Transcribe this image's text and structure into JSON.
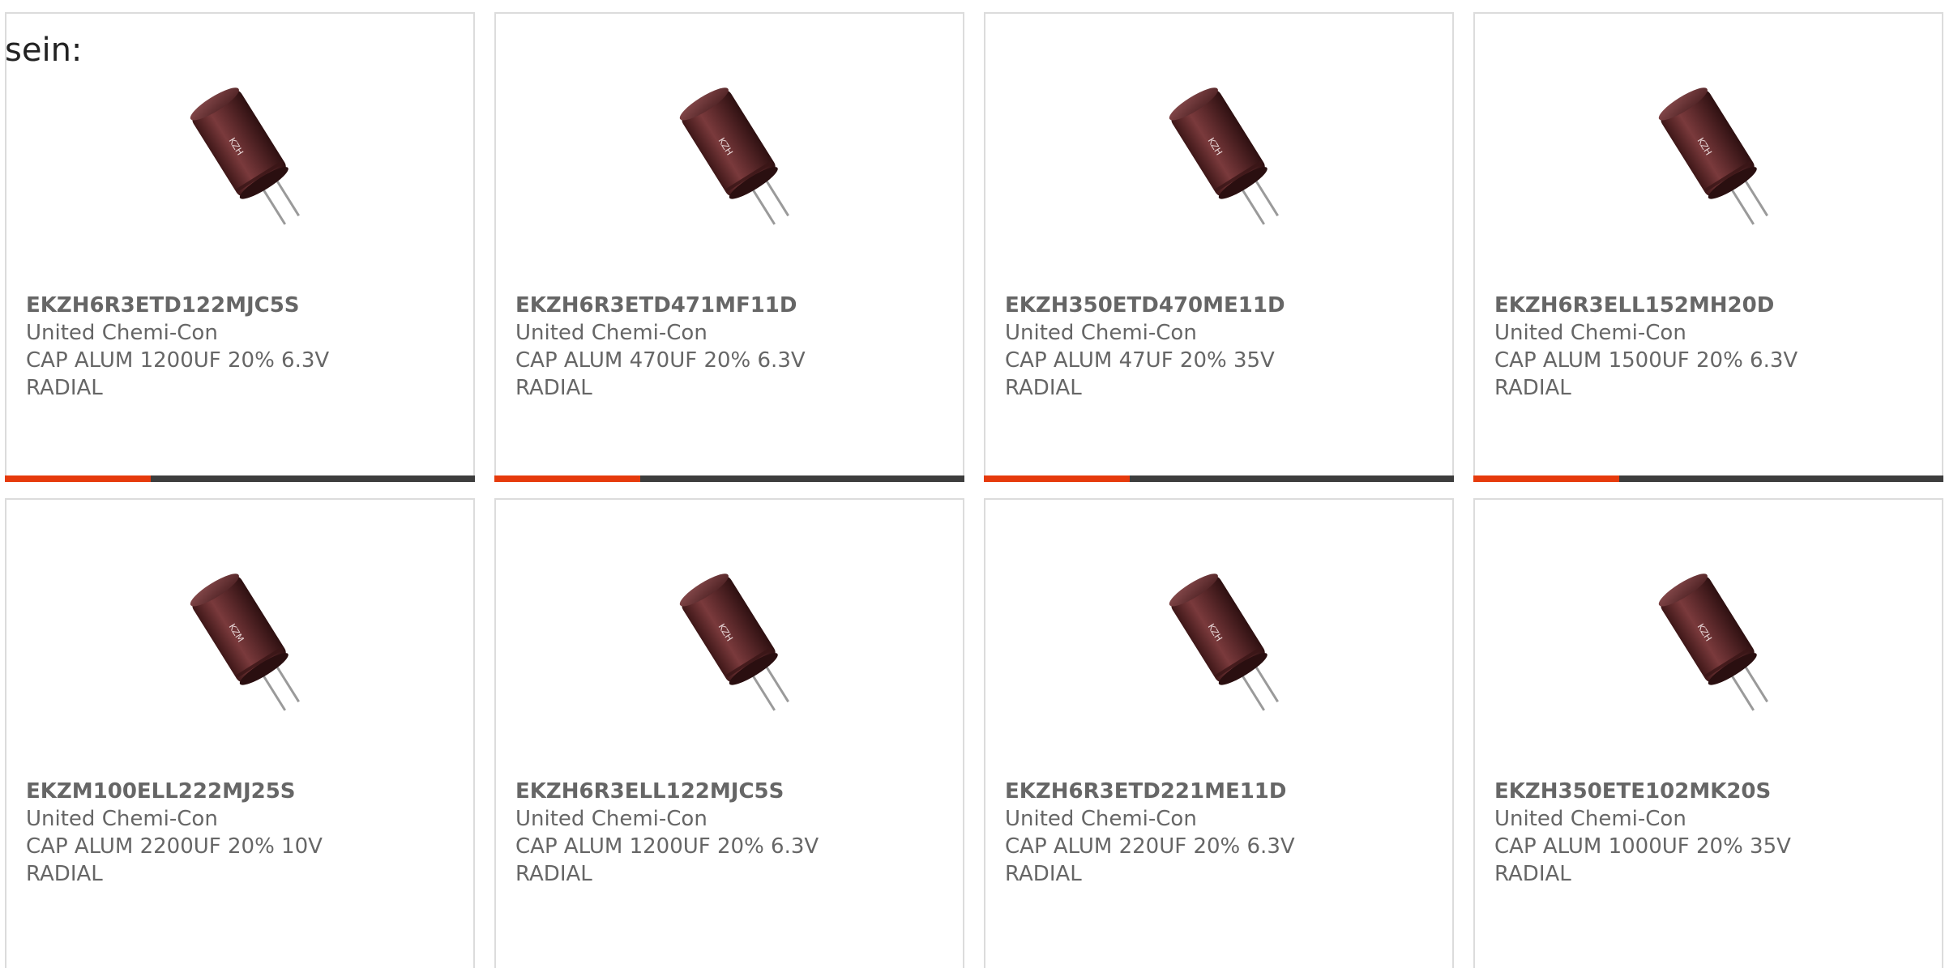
{
  "lead_text": "sein:",
  "colors": {
    "accent": "#e63a0c",
    "track": "#3d3d3d",
    "text": "#666666",
    "capacitor_body": "#5e2a2c"
  },
  "products": [
    {
      "part": "EKZH6R3ETD122MJC5S",
      "manufacturer": "United Chemi-Con",
      "description": "CAP ALUM 1200UF 20% 6.3V RADIAL",
      "sleeve_text": "KZH",
      "image_icon": "capacitor-icon",
      "progress": 0.31
    },
    {
      "part": "EKZH6R3ETD471MF11D",
      "manufacturer": "United Chemi-Con",
      "description": "CAP ALUM 470UF 20% 6.3V RADIAL",
      "sleeve_text": "KZH",
      "image_icon": "capacitor-icon",
      "progress": 0.31
    },
    {
      "part": "EKZH350ETD470ME11D",
      "manufacturer": "United Chemi-Con",
      "description": "CAP ALUM 47UF 20% 35V RADIAL",
      "sleeve_text": "KZH",
      "image_icon": "capacitor-icon",
      "progress": 0.31
    },
    {
      "part": "EKZH6R3ELL152MH20D",
      "manufacturer": "United Chemi-Con",
      "description": "CAP ALUM 1500UF 20% 6.3V RADIAL",
      "sleeve_text": "KZH",
      "image_icon": "capacitor-icon",
      "progress": 0.31
    },
    {
      "part": "EKZM100ELL222MJ25S",
      "manufacturer": "United Chemi-Con",
      "description": "CAP ALUM 2200UF 20% 10V RADIAL",
      "sleeve_text": "KZM",
      "image_icon": "capacitor-icon",
      "progress": 0
    },
    {
      "part": "EKZH6R3ELL122MJC5S",
      "manufacturer": "United Chemi-Con",
      "description": "CAP ALUM 1200UF 20% 6.3V RADIAL",
      "sleeve_text": "KZH",
      "image_icon": "capacitor-icon",
      "progress": 0
    },
    {
      "part": "EKZH6R3ETD221ME11D",
      "manufacturer": "United Chemi-Con",
      "description": "CAP ALUM 220UF 20% 6.3V RADIAL",
      "sleeve_text": "KZH",
      "image_icon": "capacitor-icon",
      "progress": 0
    },
    {
      "part": "EKZH350ETE102MK20S",
      "manufacturer": "United Chemi-Con",
      "description": "CAP ALUM 1000UF 20% 35V RADIAL",
      "sleeve_text": "KZH",
      "image_icon": "capacitor-icon",
      "progress": 0
    }
  ]
}
